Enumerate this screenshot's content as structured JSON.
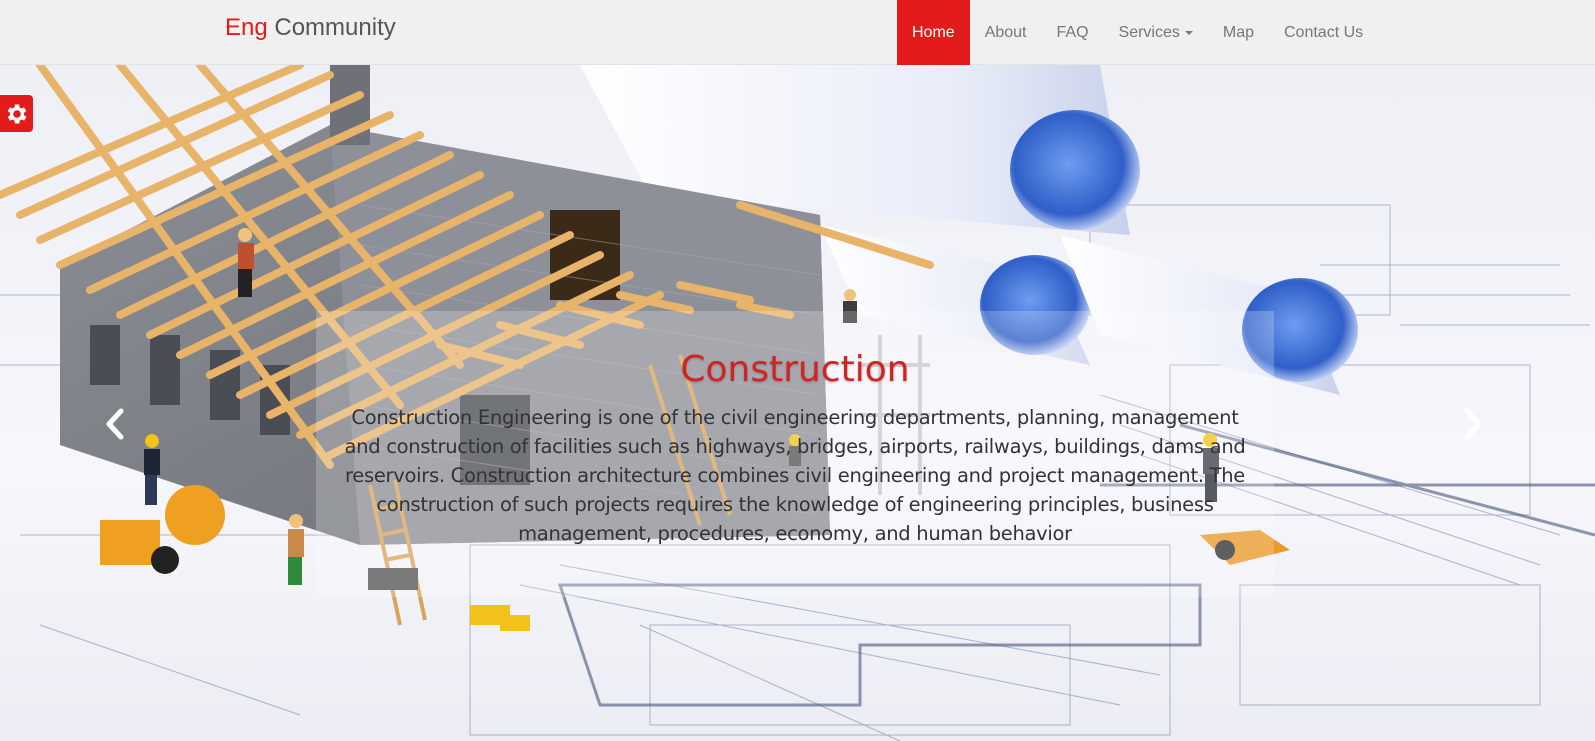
{
  "brand": {
    "accent": "Eng",
    "rest": "Community"
  },
  "nav": {
    "items": [
      {
        "label": "Home",
        "active": true
      },
      {
        "label": "About"
      },
      {
        "label": "FAQ"
      },
      {
        "label": "Services",
        "dropdown": true
      },
      {
        "label": "Map"
      },
      {
        "label": "Contact Us"
      }
    ]
  },
  "carousel": {
    "title": "Construction",
    "text": "Construction Engineering is one of the civil engineering departments, planning, management and construction of facilities such as highways, bridges, airports, railways, buildings, dams and reservoirs. Construction architecture combines civil engineering and project management. The construction of such projects requires the knowledge of engineering principles, business management, procedures, economy, and human behavior",
    "prev_icon": "chevron-left-icon",
    "next_icon": "chevron-right-icon"
  },
  "settings": {
    "icon": "gear-icon"
  },
  "colors": {
    "accent": "#e31b1b",
    "navbar_bg": "#f0f0f0",
    "nav_text": "#777777",
    "caption_title": "#d42222"
  }
}
